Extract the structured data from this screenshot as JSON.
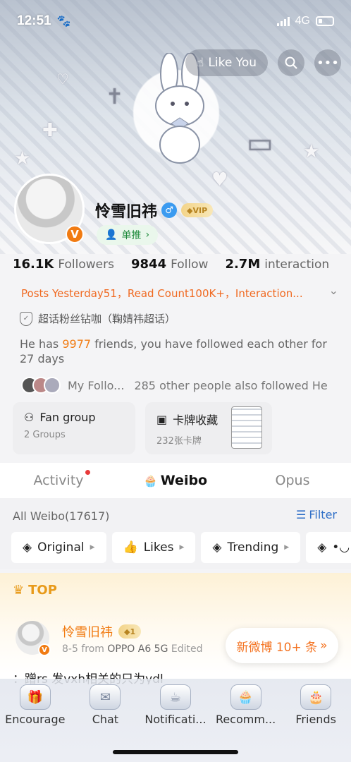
{
  "status_bar": {
    "time": "12:51",
    "network": "4G"
  },
  "header": {
    "like_you": "Like You"
  },
  "profile": {
    "name": "怜雪旧祎",
    "vip_label": "VIP",
    "push_tag": "单推",
    "stats": [
      {
        "value": "16.1K",
        "label": "Followers"
      },
      {
        "value": "9844",
        "label": "Follow"
      },
      {
        "value": "2.7M",
        "label": "interaction"
      }
    ],
    "summary_line": "Posts Yesterday51，Read Count100K+，Interaction...",
    "super_topic": "超话粉丝钻咖（鞠婧祎超话）",
    "friends_prefix": "He has ",
    "friends_count": "9977",
    "friends_suffix": " friends, you have followed each other for 27 days",
    "mutual_label": "My Follo...",
    "mutual_text": "285 other people also followed He"
  },
  "cards": [
    {
      "title": "Fan group",
      "sub": "2 Groups"
    },
    {
      "title": "卡牌收藏",
      "sub": "232张卡牌"
    }
  ],
  "tabs": [
    {
      "label": "Activity"
    },
    {
      "label": "Weibo"
    },
    {
      "label": "Opus"
    }
  ],
  "feed": {
    "all_weibo": "All Weibo(17617)",
    "filter": "Filter",
    "chips": [
      "Original",
      "Likes",
      "Trending",
      "•◡"
    ]
  },
  "top_post": {
    "top_label": "TOP",
    "name": "怜雪旧祎",
    "date": "8-5",
    "from": "from",
    "source": "OPPO A6 5G",
    "edited": "Edited",
    "text": "：蹭rs 发vxh相关的只为ydl",
    "new_pill": "新微博 10+ 条"
  },
  "bottom_nav": [
    "Encourage",
    "Chat",
    "Notificati...",
    "Recomm...",
    "Friends"
  ],
  "colors": {
    "accent_orange": "#f17b12",
    "link_blue": "#2f6fc7",
    "verified_blue": "#3b9bf0"
  }
}
